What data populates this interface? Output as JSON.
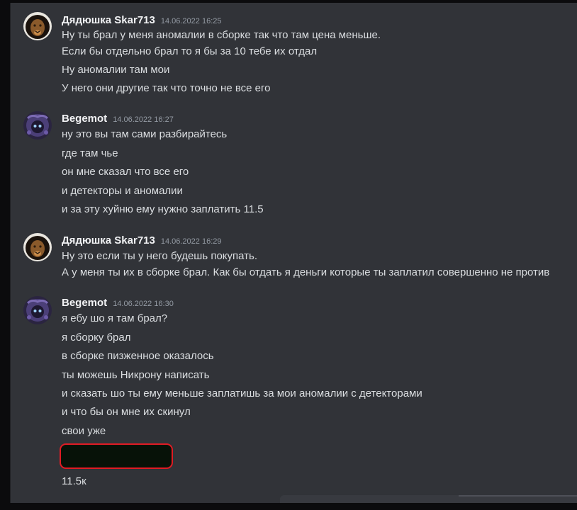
{
  "messages": [
    {
      "author": "Дядюшка Skar713",
      "timestamp": "14.06.2022 16:25",
      "avatar_icon": "lion-avatar-icon",
      "lines": [
        "Ну ты брал у меня аномалии в сборке так что там цена меньше.",
        "Если бы отдельно брал то я бы за 10 тебе их отдал",
        "Ну аномалии там мои",
        "У него они другие так что точно не все его"
      ]
    },
    {
      "author": "Begemot",
      "timestamp": "14.06.2022 16:27",
      "avatar_icon": "character-avatar-icon",
      "lines": [
        "ну это вы там сами разбирайтесь",
        "где там чье",
        "он мне сказал что все его",
        "и детекторы и аномалии",
        "и за эту хуйню ему нужно заплатить 11.5"
      ]
    },
    {
      "author": "Дядюшка Skar713",
      "timestamp": "14.06.2022 16:29",
      "avatar_icon": "lion-avatar-icon",
      "lines": [
        "Ну это если ты у него будешь покупать.",
        "А у меня ты их в сборке брал. Как бы отдать я деньги которые ты заплатил совершенно не против"
      ]
    },
    {
      "author": "Begemot",
      "timestamp": "14.06.2022 16:30",
      "avatar_icon": "character-avatar-icon",
      "lines": [
        "я ебу шо я там брал?",
        "я сборку брал",
        "в сборке пизженное оказалось",
        "ты можешь Никрону написать",
        "и сказать шо ты ему меньше заплатишь за мои аномалии с детекторами",
        "и что бы он мне их скинул",
        "свои уже"
      ],
      "after_redacted": "11.5к"
    }
  ],
  "colors": {
    "background": "#313338",
    "username": "#f2f3f5",
    "message_text": "#dbdee1",
    "timestamp": "#949ba4",
    "redaction_border": "#e01b24",
    "redaction_fill": "#071208"
  }
}
